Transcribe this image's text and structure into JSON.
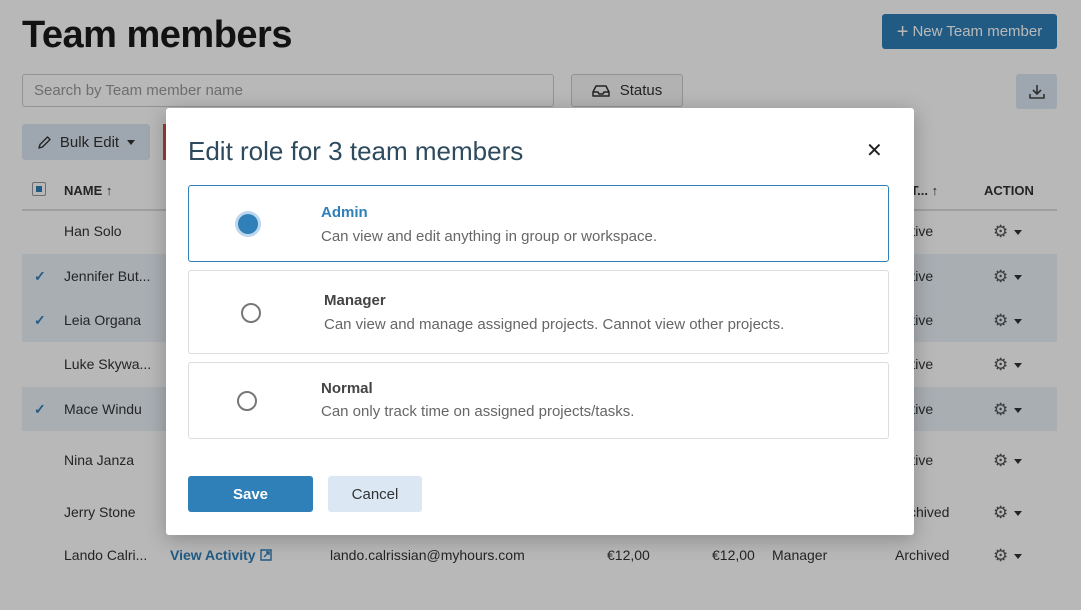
{
  "page": {
    "title": "Team members",
    "new_button_label": "New Team member",
    "search_placeholder": "Search by Team member name",
    "status_filter_label": "Status",
    "bulk_edit_label": "Bulk Edit",
    "columns": {
      "name": "NAME",
      "status": "ST...",
      "action": "ACTION"
    },
    "rows": [
      {
        "name": "Han Solo",
        "status": "Active",
        "selected": false
      },
      {
        "name": "Jennifer But...",
        "status": "Active",
        "selected": true
      },
      {
        "name": "Leia Organa",
        "status": "Active",
        "selected": true
      },
      {
        "name": "Luke Skywa...",
        "status": "Active",
        "selected": false
      },
      {
        "name": "Mace Windu",
        "status": "Active",
        "selected": true
      },
      {
        "name": "Nina Janza",
        "status": "Active",
        "selected": false
      },
      {
        "name": "Jerry Stone",
        "status": "Archived",
        "selected": false
      }
    ],
    "last_row": {
      "name": "Lando Calri...",
      "activity": "View Activity",
      "email": "lando.calrissian@myhours.com",
      "billable_rate": "€12,00",
      "labor_rate": "€12,00",
      "role": "Manager",
      "status": "Archived"
    }
  },
  "modal": {
    "title": "Edit role for 3 team members",
    "options": [
      {
        "label": "Admin",
        "description": "Can view and edit anything in group or workspace.",
        "selected": true
      },
      {
        "label": "Manager",
        "description": "Can view and manage assigned projects. Cannot view other projects.",
        "selected": false
      },
      {
        "label": "Normal",
        "description": "Can only track time on assigned projects/tasks.",
        "selected": false
      }
    ],
    "save_label": "Save",
    "cancel_label": "Cancel"
  },
  "colors": {
    "accent": "#2f7fb8",
    "selected_row": "#eaf2f9",
    "light_button": "#dbe8f3"
  }
}
